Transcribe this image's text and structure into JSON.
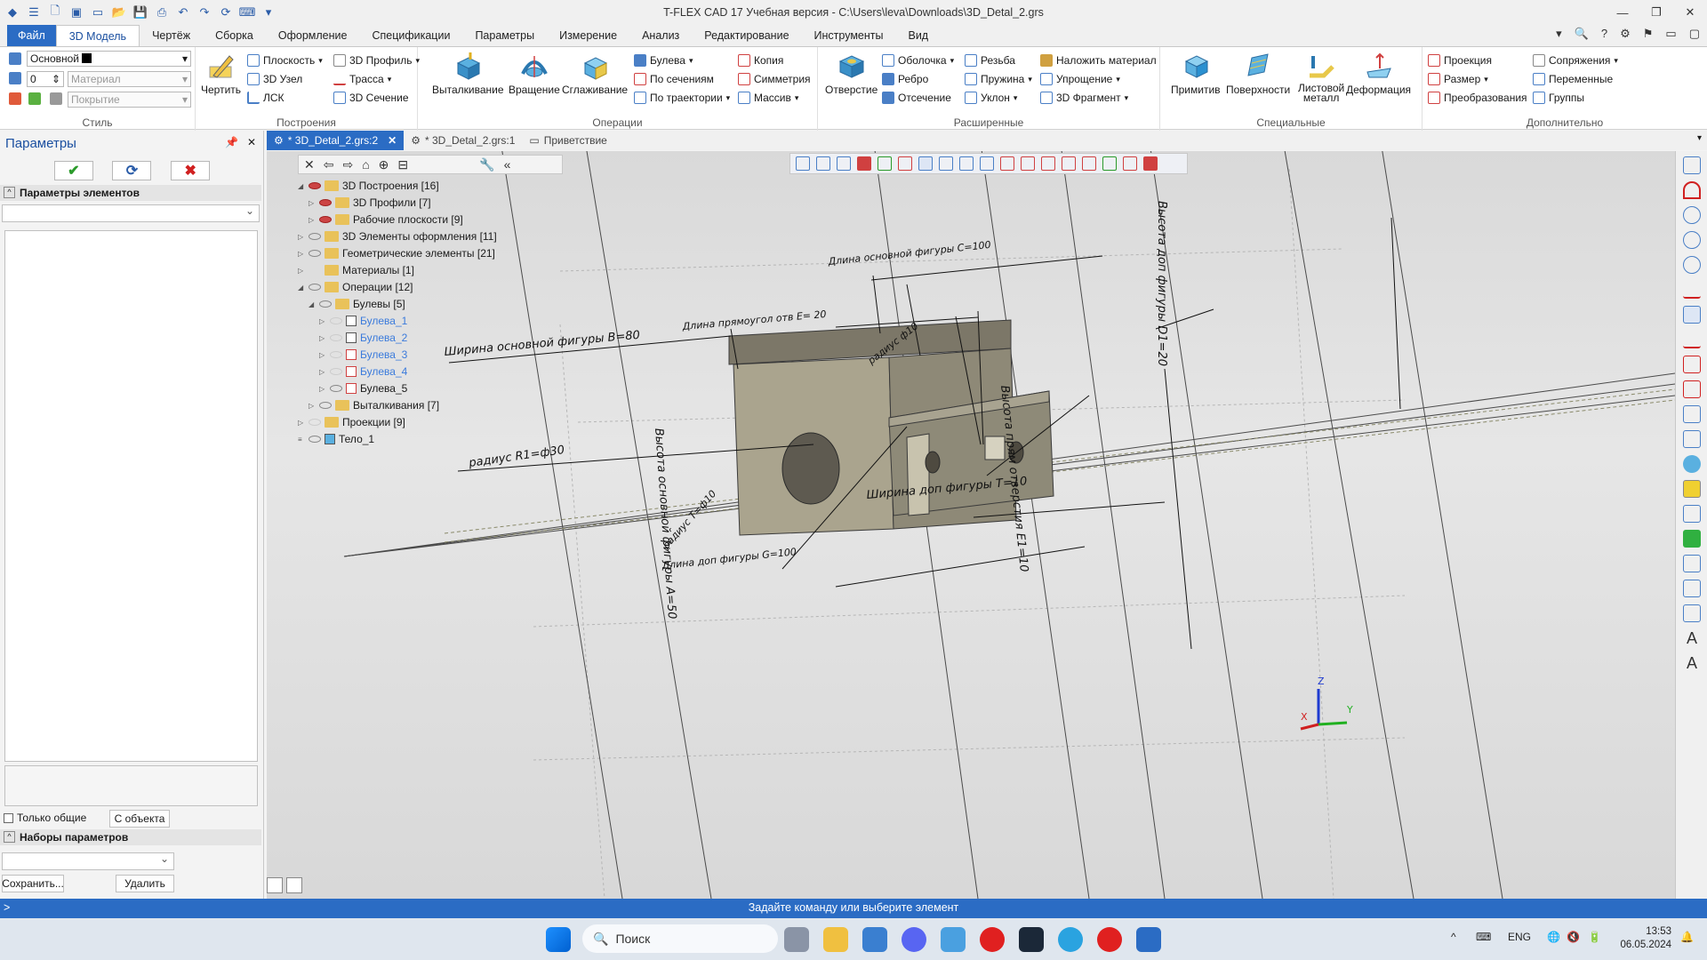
{
  "titlebar": {
    "title": "T-FLEX CAD 17 Учебная версия - C:\\Users\\leva\\Downloads\\3D_Detal_2.grs"
  },
  "ribbon_tabs": [
    "Файл",
    "3D Модель",
    "Чертёж",
    "Сборка",
    "Оформление",
    "Спецификации",
    "Параметры",
    "Измерение",
    "Анализ",
    "Редактирование",
    "Инструменты",
    "Вид"
  ],
  "active_tab": "3D Модель",
  "style_group": {
    "layer_value": "Основной",
    "level_value": "0",
    "material_placeholder": "Материал",
    "coating_placeholder": "Покрытие",
    "label": "Стиль"
  },
  "groups": {
    "construct": {
      "label": "Построения",
      "draw": "Чертить",
      "plane": "Плоскость",
      "node3d": "3D Узел",
      "lcs": "ЛСК",
      "profile3d": "3D Профиль",
      "path": "Трасса",
      "section3d": "3D Сечение"
    },
    "operations": {
      "label": "Операции",
      "extrude": "Выталкивание",
      "rotate": "Вращение",
      "loft": "Сглаживание",
      "boolean": "Булева",
      "by_sections": "По сечениям",
      "by_path": "По траектории",
      "copy": "Копия",
      "symmetry": "Симметрия",
      "array": "Массив"
    },
    "extended": {
      "label": "Расширенные",
      "hole": "Отверстие",
      "shell": "Оболочка",
      "rib": "Ребро",
      "cutoff": "Отсечение",
      "thread": "Резьба",
      "spring": "Пружина",
      "slope": "Уклон",
      "apply_material": "Наложить материал",
      "simplify": "Упрощение",
      "fragment3d": "3D Фрагмент"
    },
    "special": {
      "label": "Специальные",
      "primitive": "Примитив",
      "surfaces": "Поверхности",
      "sheet_metal_1": "Листовой",
      "sheet_metal_2": "металл",
      "deformation": "Деформация"
    },
    "additional": {
      "label": "Дополнительно",
      "projection": "Проекция",
      "dimension": "Размер",
      "transforms": "Преобразования",
      "mates": "Сопряжения",
      "variables": "Переменные",
      "groups": "Группы"
    }
  },
  "left_panel": {
    "title": "Параметры",
    "section_elements": "Параметры элементов",
    "only_common": "Только общие",
    "from_object": "С объекта",
    "section_sets": "Наборы параметров",
    "save": "Сохранить...",
    "delete": "Удалить"
  },
  "doc_tabs": [
    {
      "label": "* 3D_Detal_2.grs:2",
      "active": true
    },
    {
      "label": "* 3D_Detal_2.grs:1",
      "active": false
    },
    {
      "label": "Приветствие",
      "active": false
    }
  ],
  "tree": [
    {
      "label": "3D Построения [16]",
      "indent": 0,
      "expanded": true
    },
    {
      "label": "3D Профили [7]",
      "indent": 1
    },
    {
      "label": "Рабочие плоскости [9]",
      "indent": 1
    },
    {
      "label": "3D Элементы оформления [11]",
      "indent": 0
    },
    {
      "label": "Геометрические элементы [21]",
      "indent": 0
    },
    {
      "label": "Материалы [1]",
      "indent": 0
    },
    {
      "label": "Операции [12]",
      "indent": 0,
      "expanded": true
    },
    {
      "label": "Булевы [5]",
      "indent": 1,
      "expanded": true
    },
    {
      "label": "Булева_1",
      "indent": 2,
      "style": "blue"
    },
    {
      "label": "Булева_2",
      "indent": 2,
      "style": "blue"
    },
    {
      "label": "Булева_3",
      "indent": 2,
      "style": "blue"
    },
    {
      "label": "Булева_4",
      "indent": 2,
      "style": "blue"
    },
    {
      "label": "Булева_5",
      "indent": 2
    },
    {
      "label": "Выталкивания [7]",
      "indent": 1
    },
    {
      "label": "Проекции [9]",
      "indent": 0
    },
    {
      "label": "Тело_1",
      "indent": 0
    }
  ],
  "dimensions": {
    "width_main": "Ширина основной фигуры B=80",
    "length_main": "Длина основной фигуры C=100",
    "length_rect_hole": "Длина прямоугол отв E= 20",
    "radius10": "радиус ф10",
    "height_extra": "Высота доп фигуры D1=20",
    "radius30": "радиус R1=ф30",
    "radius_t": "радиус T=ф10",
    "width_extra": "Ширина доп фигуры T=10",
    "length_extra": "Длина доп фигуры G=100",
    "height_main": "Высота основной фигуры A=50",
    "height_rect_hole": "Высота прям отверстия E1=10"
  },
  "status": {
    "prompt": ">",
    "message": "Задайте команду или выберите элемент"
  },
  "taskbar": {
    "search": "Поиск",
    "lang": "ENG",
    "time": "13:53",
    "date": "06.05.2024"
  },
  "axes": {
    "z": "Z",
    "y": "Y",
    "x": "X"
  }
}
